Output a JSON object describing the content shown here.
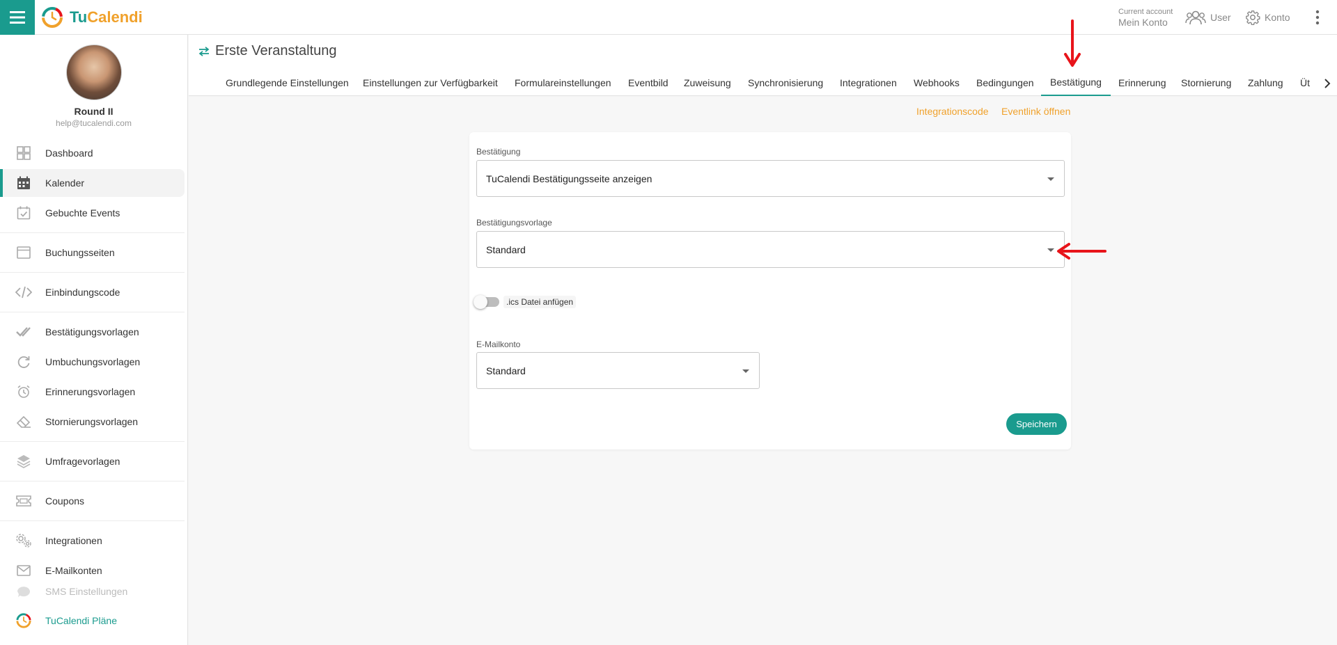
{
  "app": {
    "logo_tu": "Tu",
    "logo_cal": "Calend",
    "logo_i": "i"
  },
  "topbar": {
    "account_label": "Current account",
    "account_value": "Mein Konto",
    "user_label": "User",
    "konto_label": "Konto"
  },
  "profile": {
    "name": "Round II",
    "email": "help@tucalendi.com"
  },
  "sidebar": {
    "items": [
      {
        "label": "Dashboard"
      },
      {
        "label": "Kalender"
      },
      {
        "label": "Gebuchte Events"
      },
      {
        "label": "Buchungsseiten"
      },
      {
        "label": "Einbindungscode"
      },
      {
        "label": "Bestätigungsvorlagen"
      },
      {
        "label": "Umbuchungsvorlagen"
      },
      {
        "label": "Erinnerungsvorlagen"
      },
      {
        "label": "Stornierungsvorlagen"
      },
      {
        "label": "Umfragevorlagen"
      },
      {
        "label": "Coupons"
      },
      {
        "label": "Integrationen"
      },
      {
        "label": "E-Mailkonten"
      },
      {
        "label": "SMS Einstellungen"
      },
      {
        "label": "TuCalendi Pläne"
      }
    ]
  },
  "event": {
    "title": "Erste Veranstaltung"
  },
  "tabs": [
    {
      "label": "Grundlegende Einstellungen"
    },
    {
      "label": "Einstellungen zur Verfügbarkeit"
    },
    {
      "label": "Formulareinstellungen"
    },
    {
      "label": "Eventbild"
    },
    {
      "label": "Zuweisung"
    },
    {
      "label": "Synchronisierung"
    },
    {
      "label": "Integrationen"
    },
    {
      "label": "Webhooks"
    },
    {
      "label": "Bedingungen"
    },
    {
      "label": "Bestätigung"
    },
    {
      "label": "Erinnerung"
    },
    {
      "label": "Stornierung"
    },
    {
      "label": "Zahlung"
    },
    {
      "label": "Üt"
    }
  ],
  "links": {
    "integrationscode": "Integrationscode",
    "eventlink": "Eventlink öffnen"
  },
  "form": {
    "confirmation_label": "Bestätigung",
    "confirmation_value": "TuCalendi Bestätigungsseite anzeigen",
    "template_label": "Bestätigungsvorlage",
    "template_value": "Standard",
    "ics_label": ".ics Datei anfügen",
    "ics_enabled": false,
    "email_label": "E-Mailkonto",
    "email_value": "Standard",
    "save_label": "Speichern"
  },
  "colors": {
    "brand": "#1a9b8e",
    "accent": "#f0a12b",
    "annotation": "#e8141a"
  }
}
